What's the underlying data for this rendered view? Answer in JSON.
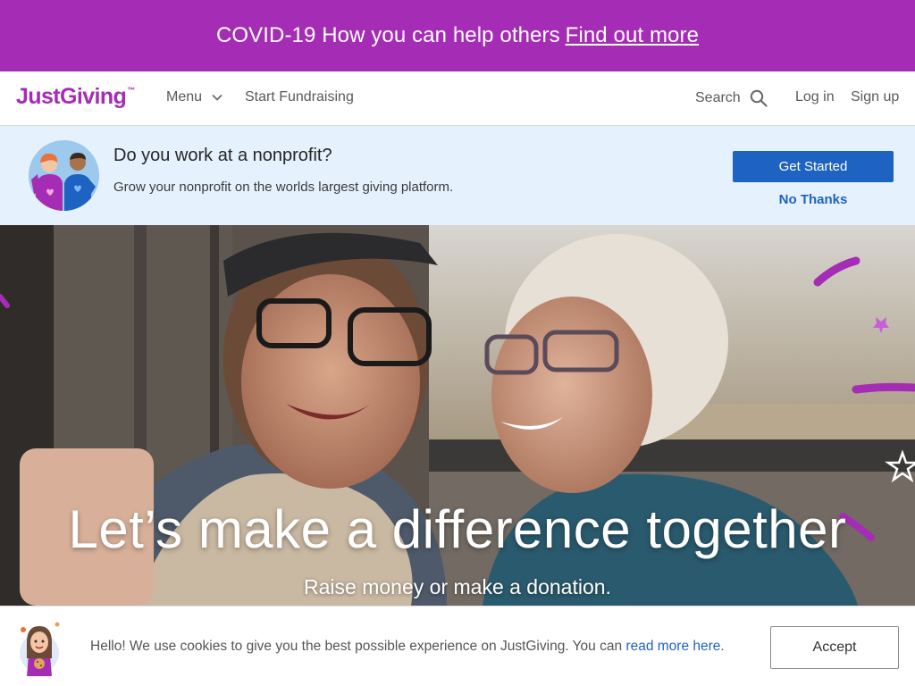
{
  "covid_banner": {
    "text": "COVID-19 How you can help others",
    "link_label": "Find out more",
    "background": "#a52db5"
  },
  "nav": {
    "logo": "JustGiving",
    "logo_tm": "™",
    "menu_label": "Menu",
    "start_fundraising": "Start Fundraising",
    "search_label": "Search",
    "login": "Log in",
    "signup": "Sign up"
  },
  "promo": {
    "title": "Do you work at a nonprofit?",
    "subtitle": "Grow your nonprofit on the worlds largest giving platform.",
    "get_started": "Get Started",
    "no_thanks": "No Thanks",
    "accent": "#1e63c2",
    "background": "#e5f1fc"
  },
  "hero": {
    "title": "Let’s make a difference together",
    "subtitle": "Raise money or make a donation."
  },
  "cookie": {
    "text": "Hello! We use cookies to give you the best possible experience on JustGiving. You can",
    "link": "read more here",
    "end": ".",
    "accept": "Accept"
  }
}
